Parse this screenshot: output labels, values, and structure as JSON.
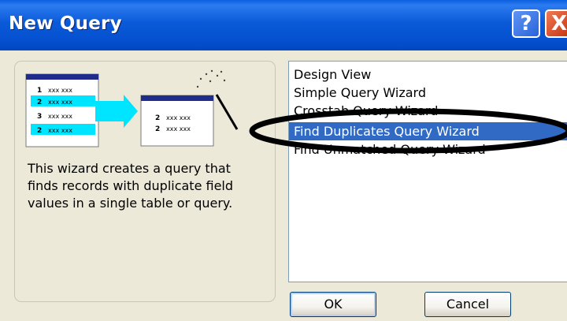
{
  "window": {
    "title": "New Query",
    "help_label": "?",
    "close_label": "X"
  },
  "description": "This wizard creates a query that finds records with duplicate field values in a single table or query.",
  "illustration": {
    "left_rows": [
      {
        "num": "1",
        "text": "xxx xxx"
      },
      {
        "num": "2",
        "text": "xxx xxx"
      },
      {
        "num": "3",
        "text": "xxx xxx"
      },
      {
        "num": "2",
        "text": "xxx xxx"
      }
    ],
    "right_rows": [
      {
        "num": "2",
        "text": "xxx xxx"
      },
      {
        "num": "2",
        "text": "xxx xxx"
      }
    ]
  },
  "list": {
    "items": [
      "Design View",
      "Simple Query Wizard",
      "Crosstab Query Wizard",
      "Find Duplicates Query Wizard",
      "Find Unmatched Query Wizard"
    ],
    "selected_index": 3
  },
  "buttons": {
    "ok": "OK",
    "cancel": "Cancel"
  },
  "colors": {
    "titlebar": "#0054e3",
    "selection": "#316ac5",
    "highlight_arrow": "#00e5ff",
    "close_button": "#d9492a"
  }
}
